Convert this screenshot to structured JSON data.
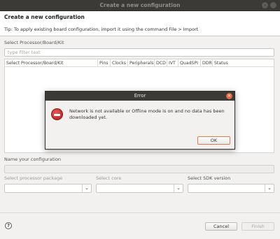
{
  "window": {
    "title": "Create a new configuration"
  },
  "banner": {
    "heading": "Create a new configuration",
    "tip": "Tip: To apply existing board configuration, import it using the command File > Import"
  },
  "processor": {
    "label": "Select Processor/Board/Kit",
    "filter_placeholder": "type filter text",
    "columns": [
      "Select Processor/Board/Kit",
      "Pins",
      "Clocks",
      "Peripherals",
      "DCD",
      "IVT",
      "QuadSPI",
      "DDR",
      "Status"
    ]
  },
  "config": {
    "name_label": "Name your configuration",
    "package_label": "Select processor package",
    "core_label": "Select core",
    "sdk_label": "Select SDK version"
  },
  "footer": {
    "help_label": "?",
    "cancel_label": "Cancel",
    "finish_label": "Finish"
  },
  "error_dialog": {
    "title": "Error",
    "message": "Network is not available or Offline mode is on and no data has been downloaded yet.",
    "ok_label": "OK"
  },
  "icons": {
    "combo_arrow": "chevron-down-icon",
    "error": "error-icon",
    "close": "close-icon"
  },
  "colors": {
    "titlebar": "#3b3a36",
    "close_button": "#e66840",
    "error_icon": "#c62828",
    "ok_focus_border": "#e07a4f"
  }
}
